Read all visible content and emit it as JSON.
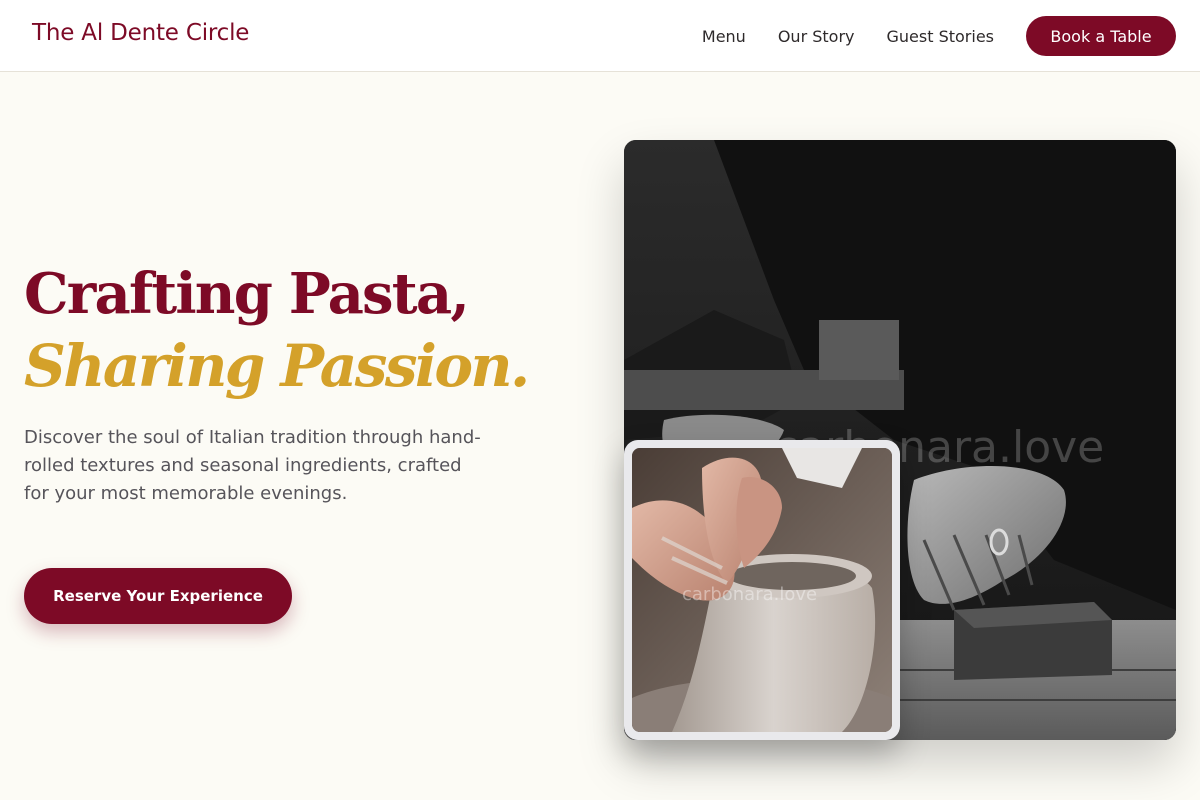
{
  "header": {
    "brand": "The Al Dente Circle",
    "nav": [
      "Menu",
      "Our Story",
      "Guest Stories"
    ],
    "book_button": "Book a Table"
  },
  "hero": {
    "title_line_1": "Crafting Pasta,",
    "title_line_2": "Sharing Passion.",
    "description": "Discover the soul of Italian tradition through hand-rolled textures and seasonal ingredients, crafted for your most memorable evenings.",
    "cta_label": "Reserve Your Experience"
  },
  "images": {
    "main_watermark": "carbonara.love",
    "inset_watermark": "carbonara.love"
  },
  "colors": {
    "brand": "#7d0a26",
    "accent_gold": "#d4a12a",
    "background": "#fcfbf5",
    "body_text": "#56545a"
  }
}
